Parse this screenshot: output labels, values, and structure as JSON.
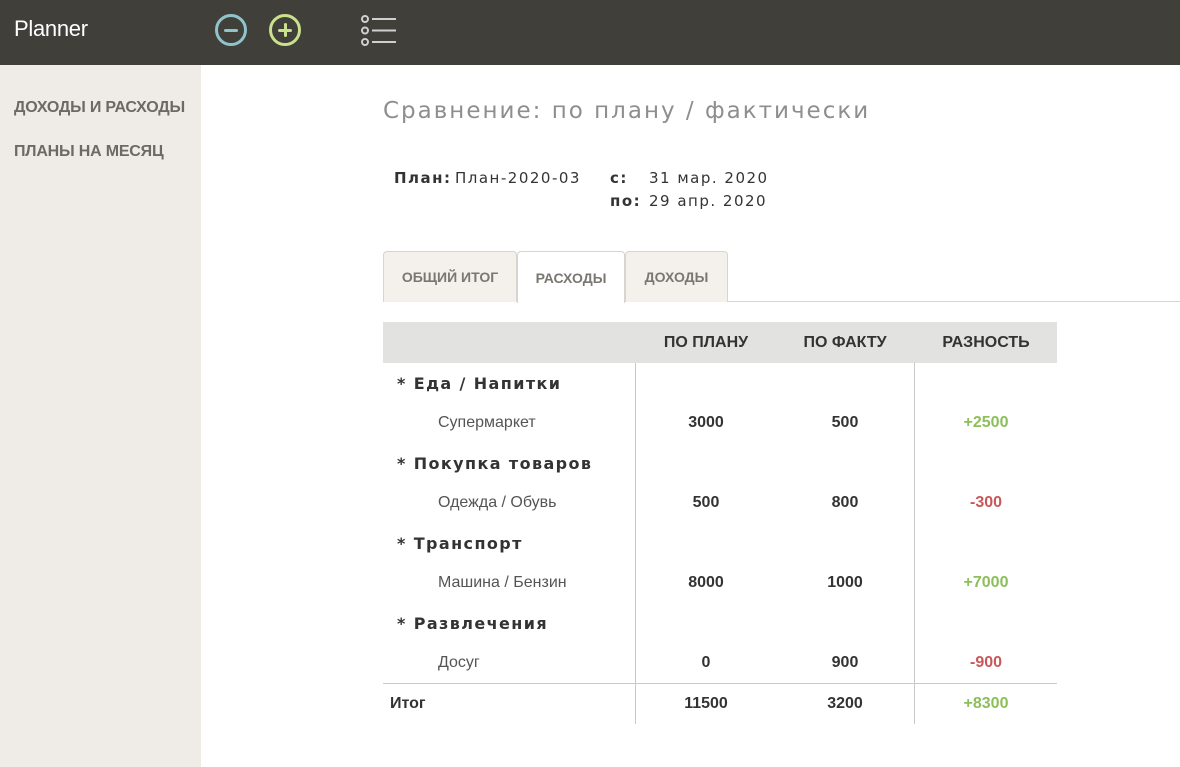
{
  "app": {
    "title": "Planner"
  },
  "toolbar": {
    "minus_icon": "minus-circle-icon",
    "plus_icon": "plus-circle-icon",
    "list_icon": "list-icon",
    "colors": {
      "topbar": "#403f3a",
      "minus": "#8fc4cb",
      "plus": "#c9e18c"
    }
  },
  "sidebar": {
    "items": [
      {
        "label": "ДОХОДЫ И РАСХОДЫ"
      },
      {
        "label": "ПЛАНЫ НА МЕСЯЦ"
      }
    ]
  },
  "page": {
    "title": "Сравнение: по плану / фактически",
    "plan_label": "План:",
    "plan_value": "План-2020-03",
    "from_label": "с:",
    "from_value": "31 мар. 2020",
    "to_label": "по:",
    "to_value": "29 апр. 2020"
  },
  "tabs": [
    {
      "label": "ОБЩИЙ ИТОГ",
      "active": false
    },
    {
      "label": "РАСХОДЫ",
      "active": true
    },
    {
      "label": "ДОХОДЫ",
      "active": false
    }
  ],
  "table": {
    "headers": {
      "name": "",
      "plan": "ПО ПЛАНУ",
      "fact": "ПО ФАКТУ",
      "diff": "РАЗНОСТЬ"
    },
    "groups": [
      {
        "category": "* Еда / Напитки",
        "item": "Супермаркет",
        "plan": "3000",
        "fact": "500",
        "diff": "+2500"
      },
      {
        "category": "* Покупка товаров",
        "item": "Одежда / Обувь",
        "plan": "500",
        "fact": "800",
        "diff": "-300"
      },
      {
        "category": "* Транспорт",
        "item": "Машина / Бензин",
        "plan": "8000",
        "fact": "1000",
        "diff": "+7000"
      },
      {
        "category": "* Развлечения",
        "item": "Досуг",
        "plan": "0",
        "fact": "900",
        "diff": "-900"
      }
    ],
    "total": {
      "label": "Итог",
      "plan": "11500",
      "fact": "3200",
      "diff": "+8300"
    },
    "colors": {
      "positive": "#8cbf5a",
      "negative": "#c9575a",
      "header_bg": "#e2e2e0"
    }
  }
}
